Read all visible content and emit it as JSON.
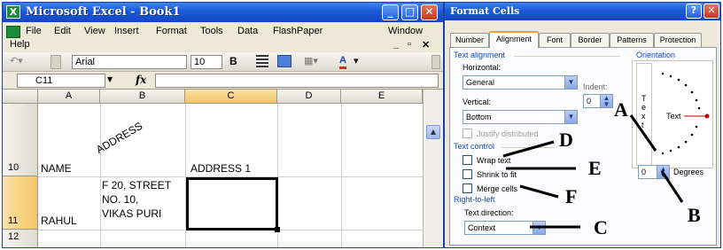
{
  "excel": {
    "title": "Microsoft Excel - Book1",
    "app_icon_glyph": "X",
    "menus": [
      "File",
      "Edit",
      "View",
      "Insert",
      "Format",
      "Tools",
      "Data",
      "FlashPaper",
      "Window",
      "Help"
    ],
    "toolbar": {
      "font": "Arial",
      "size": "10",
      "bold": "B"
    },
    "name_box": "C11",
    "fx": "fx",
    "columns": [
      "A",
      "B",
      "C",
      "D",
      "E"
    ],
    "rows": [
      "10",
      "11",
      "12"
    ],
    "cells": {
      "a10": "NAME",
      "b10": "ADDRESS",
      "c10": "ADDRESS 1",
      "a11": "RAHUL",
      "b11": [
        "F 20, STREET",
        "NO. 10,",
        "VIKAS PURI"
      ]
    }
  },
  "dialog": {
    "title": "Format Cells",
    "help": "?",
    "tabs": [
      "Number",
      "Alignment",
      "Font",
      "Border",
      "Patterns",
      "Protection"
    ],
    "active_tab": "Alignment",
    "text_alignment": {
      "label": "Text alignment",
      "horizontal_label": "Horizontal:",
      "horizontal_value": "General",
      "indent_label": "Indent:",
      "indent_value": "0",
      "vertical_label": "Vertical:",
      "vertical_value": "Bottom",
      "justify_distributed": "Justify distributed"
    },
    "text_control": {
      "label": "Text control",
      "wrap_text": "Wrap text",
      "shrink_to_fit": "Shrink to fit",
      "merge_cells": "Merge cells"
    },
    "right_to_left": {
      "label": "Right-to-left",
      "direction_label": "Text direction:",
      "direction_value": "Context"
    },
    "orientation": {
      "label": "Orientation",
      "vertical_text": [
        "T",
        "e",
        "x",
        "t"
      ],
      "text_label": "Text",
      "degrees_value": "0",
      "degrees_label": "Degrees"
    }
  },
  "callouts": [
    "A",
    "B",
    "C",
    "D",
    "E",
    "F"
  ]
}
